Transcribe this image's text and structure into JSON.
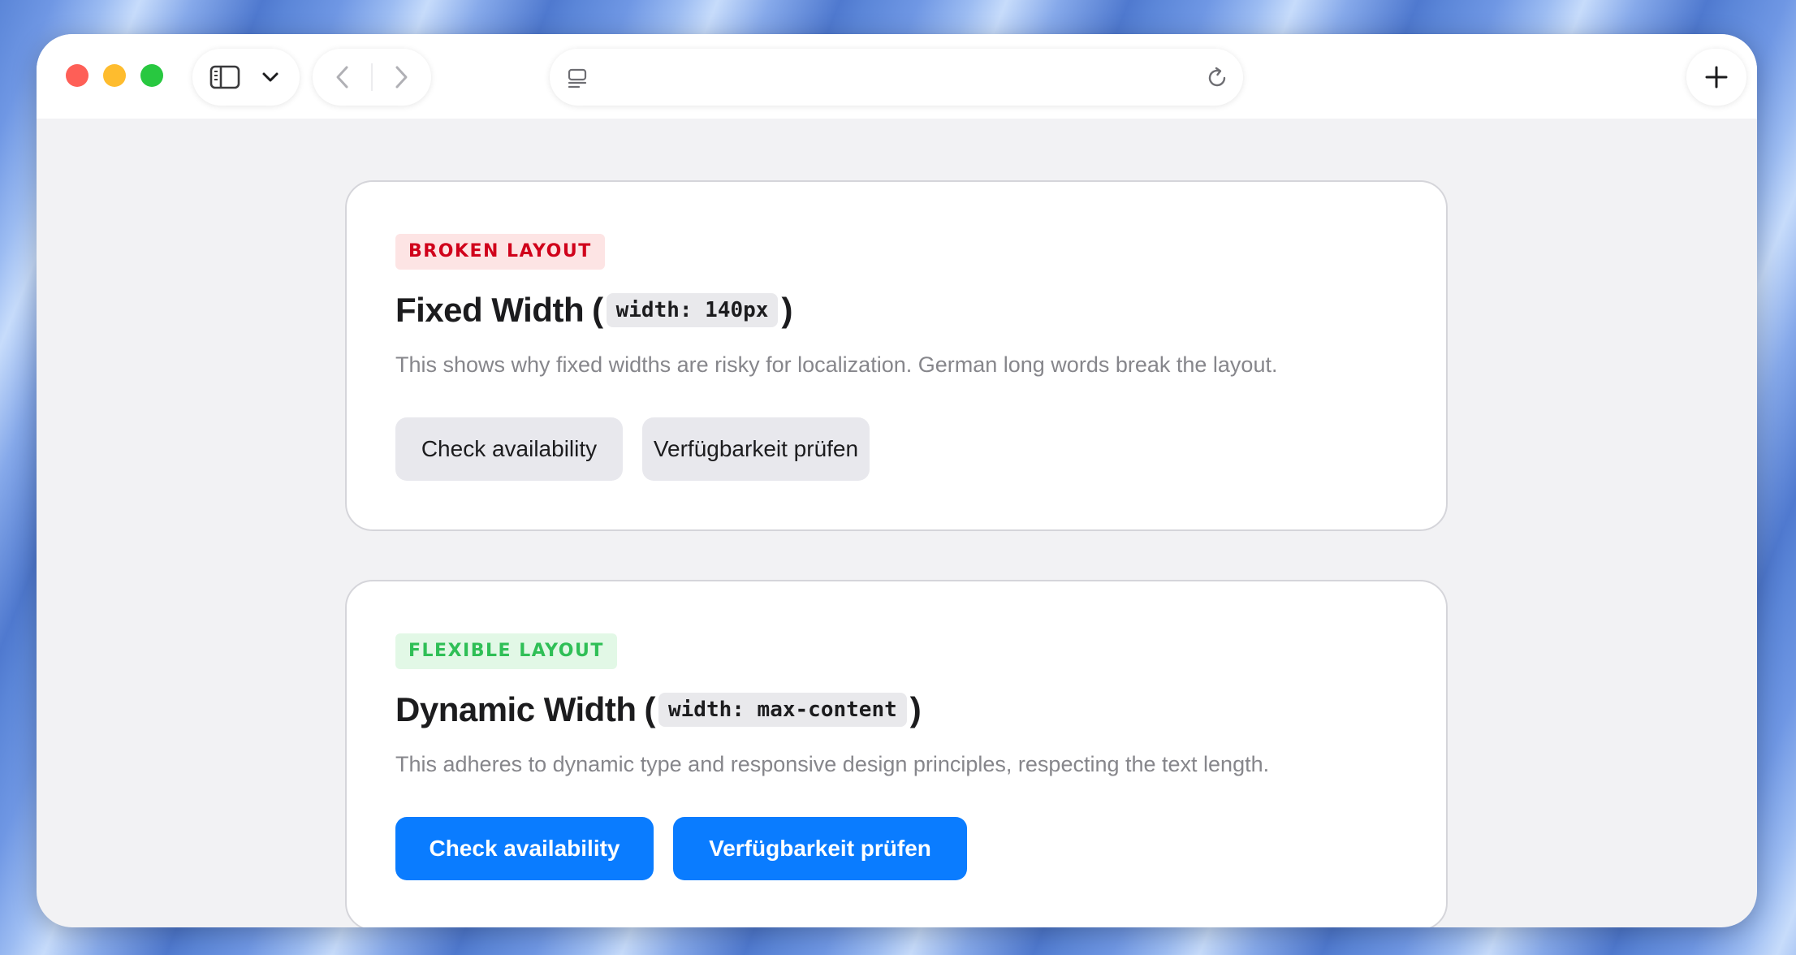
{
  "browser": {
    "address_bar_value": "",
    "sidebar_icon": "sidebar-icon",
    "chevron_icon": "chevron-down-icon",
    "back_icon": "chevron-left-icon",
    "forward_icon": "chevron-right-icon",
    "reader_icon": "reader-icon",
    "reload_icon": "reload-icon",
    "new_tab_icon": "plus-icon",
    "colors": {
      "close": "#fe5f57",
      "minimize": "#febc2e",
      "zoom": "#28c840"
    }
  },
  "cards": [
    {
      "badge": "BROKEN LAYOUT",
      "badge_color": "#d0021b",
      "title_text": "Fixed Width",
      "open_paren": "(",
      "code": "width: 140px",
      "close_paren": ")",
      "description": "This shows why fixed widths are risky for localization. German long words break the layout.",
      "buttons": [
        "Check availability",
        "Verfügbarkeit prüfen"
      ]
    },
    {
      "badge": "FLEXIBLE LAYOUT",
      "badge_color": "#2fbf56",
      "title_text": "Dynamic Width",
      "open_paren": "(",
      "code": "width: max-content",
      "close_paren": ")",
      "description": "This adheres to dynamic type and responsive design principles, respecting the text length.",
      "buttons": [
        "Check availability",
        "Verfügbarkeit prüfen"
      ],
      "button_color": "#0a7cff"
    }
  ]
}
